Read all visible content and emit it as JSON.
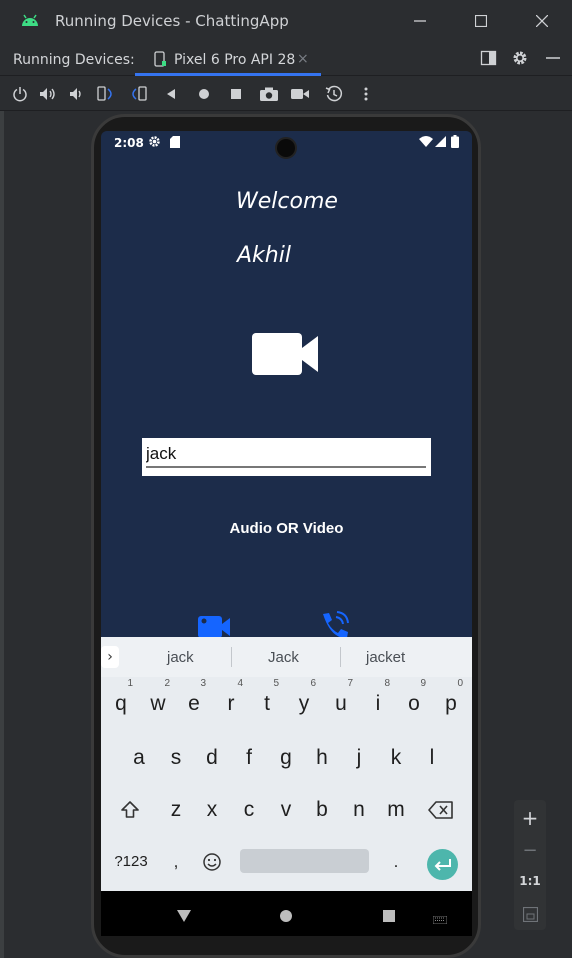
{
  "window": {
    "title": "Running Devices - ChattingApp"
  },
  "tabbar": {
    "label": "Running Devices:",
    "tab_label": "Pixel 6 Pro API 28",
    "tab_close": "×"
  },
  "status": {
    "time": "2:08"
  },
  "app": {
    "welcome": "Welcome",
    "user_name": "Akhil",
    "input_value": "jack",
    "mode_text": "Audio OR Video"
  },
  "keyboard": {
    "suggestions": [
      "jack",
      "Jack",
      "jacket"
    ],
    "row1": [
      [
        "q",
        "1"
      ],
      [
        "w",
        "2"
      ],
      [
        "e",
        "3"
      ],
      [
        "r",
        "4"
      ],
      [
        "t",
        "5"
      ],
      [
        "y",
        "6"
      ],
      [
        "u",
        "7"
      ],
      [
        "i",
        "8"
      ],
      [
        "o",
        "9"
      ],
      [
        "p",
        "0"
      ]
    ],
    "row2": [
      "a",
      "s",
      "d",
      "f",
      "g",
      "h",
      "j",
      "k",
      "l"
    ],
    "row3": [
      "z",
      "x",
      "c",
      "v",
      "b",
      "n",
      "m"
    ],
    "sym_label": "?123",
    "comma": ",",
    "period": "."
  },
  "zoom": {
    "plus": "+",
    "minus": "−",
    "ratio": "1:1"
  },
  "colors": {
    "accent": "#3574f0",
    "app_bg": "#1c2c4a",
    "icon_blue": "#1565ff",
    "enter_key": "#4db6ac"
  }
}
